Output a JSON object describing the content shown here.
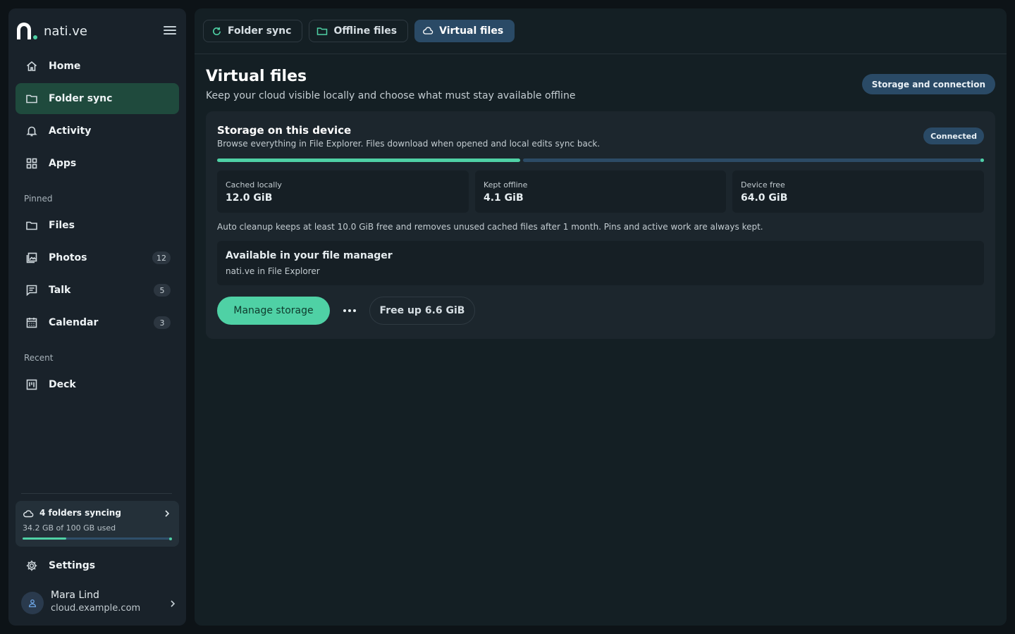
{
  "app": {
    "brand": "nati.ve"
  },
  "sidebar": {
    "nav": [
      {
        "label": "Home",
        "icon": "home-icon"
      },
      {
        "label": "Folder sync",
        "icon": "folder-icon",
        "active": true
      },
      {
        "label": "Activity",
        "icon": "bell-icon"
      },
      {
        "label": "Apps",
        "icon": "grid-icon"
      }
    ],
    "pinned_label": "Pinned",
    "pinned": [
      {
        "label": "Files",
        "icon": "folder-icon"
      },
      {
        "label": "Photos",
        "icon": "image-icon",
        "badge": "12"
      },
      {
        "label": "Talk",
        "icon": "chat-icon",
        "badge": "5"
      },
      {
        "label": "Calendar",
        "icon": "calendar-icon",
        "badge": "3"
      }
    ],
    "recent_label": "Recent",
    "recent": [
      {
        "label": "Deck",
        "icon": "deck-icon"
      }
    ],
    "sync_card": {
      "title": "4 folders syncing",
      "usage": "34.2 GB of 100 GB used",
      "usage_fraction": 0.342
    },
    "settings_label": "Settings",
    "user": {
      "name": "Mara Lind",
      "host": "cloud.example.com"
    }
  },
  "tabs": [
    {
      "label": "Folder sync",
      "icon": "refresh-icon",
      "active": false
    },
    {
      "label": "Offline files",
      "icon": "folder-icon",
      "active": false
    },
    {
      "label": "Virtual files",
      "icon": "cloud-icon",
      "active": true
    }
  ],
  "page": {
    "title": "Virtual files",
    "subtitle": "Keep your cloud visible locally and choose what must stay available offline",
    "storage_button": "Storage and connection"
  },
  "storage_card": {
    "title": "Storage on this device",
    "subtitle": "Browse everything in File Explorer. Files download when opened and local edits sync back.",
    "status": "Connected",
    "usage_fraction": 0.395,
    "stats": [
      {
        "label": "Cached locally",
        "value": "12.0 GiB"
      },
      {
        "label": "Kept offline",
        "value": "4.1 GiB"
      },
      {
        "label": "Device free",
        "value": "64.0 GiB"
      }
    ],
    "cleanup_note": "Auto cleanup keeps at least 10.0 GiB free and removes unused cached files after 1 month. Pins and active work are always kept.",
    "file_manager": {
      "title": "Available in your file manager",
      "subtitle": "nati.ve in File Explorer"
    },
    "manage_button": "Manage storage",
    "free_up_button": "Free up 6.6 GiB"
  },
  "colors": {
    "accent": "#4fd1a5",
    "active_nav": "#1f4a3d",
    "active_tab": "#2a4a66",
    "background": "#0d1317"
  }
}
